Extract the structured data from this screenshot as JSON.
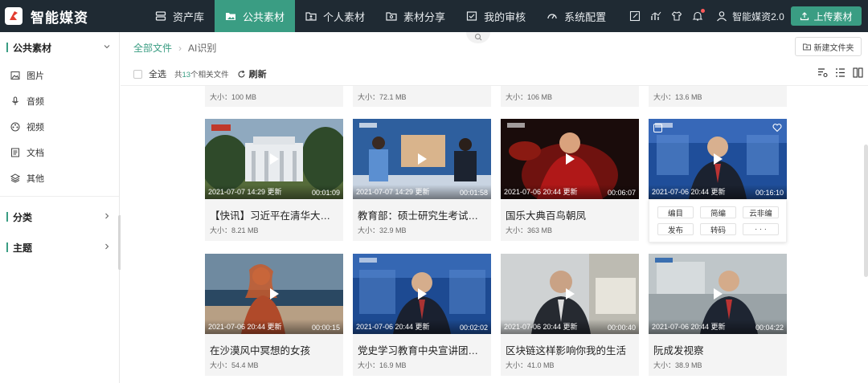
{
  "brand": {
    "title": "智能媒资"
  },
  "nav": [
    {
      "label": "资产库",
      "icon": "server-icon"
    },
    {
      "label": "公共素材",
      "icon": "folder-image-icon"
    },
    {
      "label": "个人素材",
      "icon": "user-folder-icon"
    },
    {
      "label": "素材分享",
      "icon": "share-folder-icon"
    },
    {
      "label": "我的审核",
      "icon": "review-icon"
    },
    {
      "label": "系统配置",
      "icon": "dashboard-icon"
    }
  ],
  "user": {
    "name": "智能媒资2.0"
  },
  "upload": {
    "label": "上传素材"
  },
  "sidebar": {
    "public_group": "公共素材",
    "items": [
      {
        "label": "图片",
        "icon": "image-icon"
      },
      {
        "label": "音频",
        "icon": "microphone-icon"
      },
      {
        "label": "视频",
        "icon": "film-reel-icon"
      },
      {
        "label": "文档",
        "icon": "document-icon"
      },
      {
        "label": "其他",
        "icon": "layers-icon"
      }
    ],
    "category_group": "分类",
    "topic_group": "主题"
  },
  "breadcrumb": {
    "root": "全部文件",
    "current": "AI识别"
  },
  "new_folder": {
    "label": "新建文件夹"
  },
  "toolbar": {
    "select_all": "全选",
    "count_prefix": "共",
    "count": "13",
    "count_suffix": "个相关文件",
    "refresh": "刷新"
  },
  "top_row_sizes": [
    "大小：100 MB",
    "大小：72.1 MB",
    "大小：106 MB",
    "大小：13.6 MB"
  ],
  "cards": [
    {
      "date": "2021-07-07 14:29 更新",
      "duration": "00:01:09",
      "title": "【快讯】习近平在清华大学考察",
      "size": "大小：8.21 MB",
      "scene": "campus"
    },
    {
      "date": "2021-07-07 14:29 更新",
      "duration": "00:01:58",
      "title": "教育部：硕士研究生考试鼓励人才",
      "size": "大小：32.9 MB",
      "scene": "studio"
    },
    {
      "date": "2021-07-06 20:44 更新",
      "duration": "00:06:07",
      "title": "国乐大典百鸟朝凤",
      "size": "大小：363 MB",
      "scene": "stage"
    },
    {
      "date": "2021-07-06 20:44 更新",
      "duration": "00:16:10",
      "title": "",
      "size": "",
      "scene": "anchor"
    },
    {
      "date": "2021-07-06 20:44 更新",
      "duration": "00:00:15",
      "title": "在沙漠风中冥想的女孩",
      "size": "大小：54.4 MB",
      "scene": "desert"
    },
    {
      "date": "2021-07-06 20:44 更新",
      "duration": "00:02:02",
      "title": "党史学习教育中央宣讲团报告会",
      "size": "大小：16.9 MB",
      "scene": "anchor"
    },
    {
      "date": "2021-07-06 20:44 更新",
      "duration": "00:00:40",
      "title": "区块链这样影响你我的生活",
      "size": "大小：41.0 MB",
      "scene": "interview"
    },
    {
      "date": "2021-07-06 20:44 更新",
      "duration": "00:04:22",
      "title": "阮成发视察",
      "size": "大小：38.9 MB",
      "scene": "anchor-light"
    }
  ],
  "card_actions": [
    "编目",
    "简编",
    "云非编",
    "发布",
    "转码",
    "· · ·"
  ],
  "colors": {
    "topbar": "#1f2a33",
    "accent": "#3a9d83",
    "notify": "#ff5a5a"
  }
}
